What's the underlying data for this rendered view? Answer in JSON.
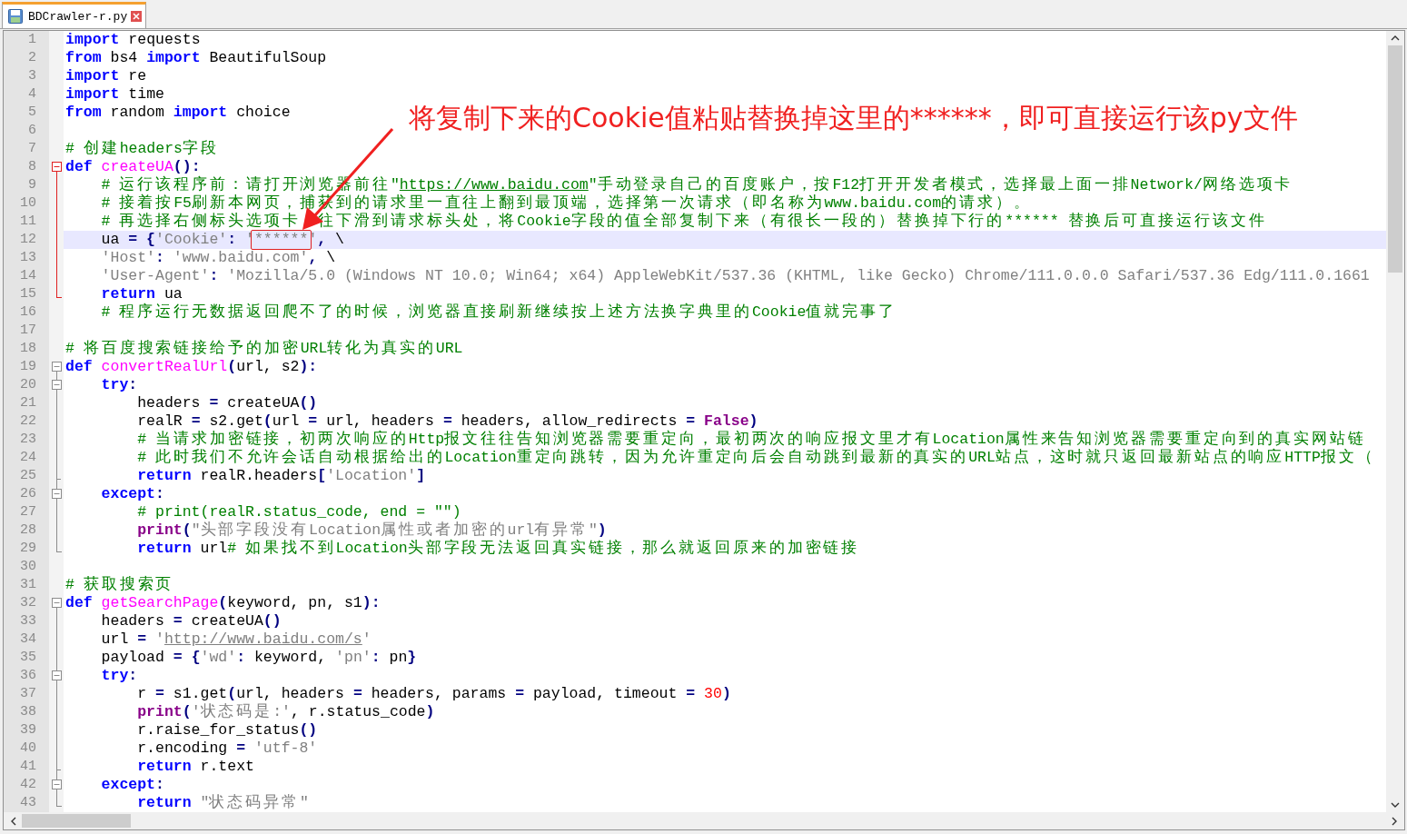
{
  "tabs": [
    {
      "title": "BDCrawler-r.py",
      "selected": true
    }
  ],
  "annotation": {
    "text": "将复制下来的Cookie值粘贴替换掉这里的******，即可直接运行该py文件"
  },
  "lines": [
    {
      "number": "1",
      "current": false,
      "tokens": [
        {
          "kind": "kw",
          "text": "import"
        },
        {
          "kind": "plain",
          "text": " requests"
        }
      ]
    },
    {
      "number": "2",
      "current": false,
      "tokens": [
        {
          "kind": "kw",
          "text": "from"
        },
        {
          "kind": "plain",
          "text": " bs4 "
        },
        {
          "kind": "kw",
          "text": "import"
        },
        {
          "kind": "plain",
          "text": " BeautifulSoup"
        }
      ]
    },
    {
      "number": "3",
      "current": false,
      "tokens": [
        {
          "kind": "kw",
          "text": "import"
        },
        {
          "kind": "plain",
          "text": " re"
        }
      ]
    },
    {
      "number": "4",
      "current": false,
      "tokens": [
        {
          "kind": "kw",
          "text": "import"
        },
        {
          "kind": "plain",
          "text": " time"
        }
      ]
    },
    {
      "number": "5",
      "current": false,
      "tokens": [
        {
          "kind": "kw",
          "text": "from"
        },
        {
          "kind": "plain",
          "text": " random "
        },
        {
          "kind": "kw",
          "text": "import"
        },
        {
          "kind": "plain",
          "text": " choice"
        }
      ]
    },
    {
      "number": "6",
      "current": false
    },
    {
      "number": "7",
      "current": false,
      "tokens": [
        {
          "kind": "cm",
          "text": "# 创建headers字段"
        }
      ]
    },
    {
      "number": "8",
      "current": false,
      "fold": {
        "kind": "open",
        "active": true
      },
      "tokens": [
        {
          "kind": "kw",
          "text": "def "
        },
        {
          "kind": "fn",
          "text": "createUA"
        },
        {
          "kind": "op",
          "text": "():"
        }
      ]
    },
    {
      "number": "9",
      "current": false,
      "fold": {
        "kind": "line",
        "active": true
      },
      "tokens": [
        {
          "kind": "cm",
          "text": "    # 运行该程序前：请打开浏览器前往\""
        },
        {
          "kind": "cmlink",
          "text": "https://www.baidu.com"
        },
        {
          "kind": "cm",
          "text": "\"手动登录自己的百度账户，按F12打开开发者模式，选择最上面一排Network/网络选项卡"
        }
      ]
    },
    {
      "number": "10",
      "current": false,
      "fold": {
        "kind": "line",
        "active": true
      },
      "tokens": [
        {
          "kind": "cm",
          "text": "    # 接着按F5刷新本网页，捕获到的请求里一直往上翻到最顶端，选择第一次请求（即名称为www.baidu.com的请求）。"
        }
      ]
    },
    {
      "number": "11",
      "current": false,
      "fold": {
        "kind": "line",
        "active": true
      },
      "tokens": [
        {
          "kind": "cm",
          "text": "    # 再选择右侧标头选项卡　往下滑到请求标头处，将Cookie字段的值全部复制下来（有很长一段的）替换掉下行的****** 替换后可直接运行该文件"
        }
      ]
    },
    {
      "number": "12",
      "current": true,
      "fold": {
        "kind": "line",
        "active": true
      },
      "tokens": [
        {
          "kind": "plain",
          "text": "    ua "
        },
        {
          "kind": "op",
          "text": "= {"
        },
        {
          "kind": "str",
          "text": "'Cookie'"
        },
        {
          "kind": "op",
          "text": ":"
        },
        {
          "kind": "str",
          "text": " '"
        },
        {
          "kind": "str",
          "text": "******",
          "boxed": true
        },
        {
          "kind": "str",
          "text": "'"
        },
        {
          "kind": "op",
          "text": ","
        },
        {
          "kind": "plain",
          "text": " \\"
        }
      ]
    },
    {
      "number": "13",
      "current": false,
      "fold": {
        "kind": "line",
        "active": true
      },
      "tokens": [
        {
          "kind": "str",
          "text": "    'Host'"
        },
        {
          "kind": "op",
          "text": ":"
        },
        {
          "kind": "str",
          "text": " 'www.baidu.com'"
        },
        {
          "kind": "op",
          "text": ","
        },
        {
          "kind": "plain",
          "text": " \\"
        }
      ]
    },
    {
      "number": "14",
      "current": false,
      "fold": {
        "kind": "line",
        "active": true
      },
      "tokens": [
        {
          "kind": "str",
          "text": "    'User-Agent'"
        },
        {
          "kind": "op",
          "text": ":"
        },
        {
          "kind": "str",
          "text": " 'Mozilla/5.0 (Windows NT 10.0; Win64; x64) AppleWebKit/537.36 (KHTML, like Gecko) Chrome/111.0.0.0 Safari/537.36 Edg/111.0.1661"
        }
      ]
    },
    {
      "number": "15",
      "current": false,
      "fold": {
        "kind": "end",
        "active": true
      },
      "tokens": [
        {
          "kind": "kw",
          "text": "    return"
        },
        {
          "kind": "plain",
          "text": " ua"
        }
      ]
    },
    {
      "number": "16",
      "current": false,
      "tokens": [
        {
          "kind": "cm",
          "text": "    # 程序运行无数据返回爬不了的时候，浏览器直接刷新继续按上述方法换字典里的Cookie值就完事了"
        }
      ]
    },
    {
      "number": "17",
      "current": false
    },
    {
      "number": "18",
      "current": false,
      "tokens": [
        {
          "kind": "cm",
          "text": "# 将百度搜索链接给予的加密URL转化为真实的URL"
        }
      ]
    },
    {
      "number": "19",
      "current": false,
      "fold": {
        "kind": "open",
        "active": false
      },
      "tokens": [
        {
          "kind": "kw",
          "text": "def "
        },
        {
          "kind": "fn",
          "text": "convertRealUrl"
        },
        {
          "kind": "op",
          "text": "("
        },
        {
          "kind": "plain",
          "text": "url, s2"
        },
        {
          "kind": "op",
          "text": "):"
        }
      ]
    },
    {
      "number": "20",
      "current": false,
      "fold": {
        "kind": "open",
        "active": false
      },
      "tokens": [
        {
          "kind": "kw",
          "text": "    try"
        },
        {
          "kind": "op",
          "text": ":"
        }
      ]
    },
    {
      "number": "21",
      "current": false,
      "fold": {
        "kind": "line",
        "active": false
      },
      "tokens": [
        {
          "kind": "plain",
          "text": "        headers "
        },
        {
          "kind": "op",
          "text": "="
        },
        {
          "kind": "plain",
          "text": " createUA"
        },
        {
          "kind": "op",
          "text": "()"
        }
      ]
    },
    {
      "number": "22",
      "current": false,
      "fold": {
        "kind": "line",
        "active": false
      },
      "tokens": [
        {
          "kind": "plain",
          "text": "        realR "
        },
        {
          "kind": "op",
          "text": "="
        },
        {
          "kind": "plain",
          "text": " s2.get"
        },
        {
          "kind": "op",
          "text": "("
        },
        {
          "kind": "plain",
          "text": "url "
        },
        {
          "kind": "op",
          "text": "="
        },
        {
          "kind": "plain",
          "text": " url, headers "
        },
        {
          "kind": "op",
          "text": "="
        },
        {
          "kind": "plain",
          "text": " headers, allow_redirects "
        },
        {
          "kind": "op",
          "text": "="
        },
        {
          "kind": "builtin",
          "text": " False"
        },
        {
          "kind": "op",
          "text": ")"
        }
      ]
    },
    {
      "number": "23",
      "current": false,
      "fold": {
        "kind": "line",
        "active": false
      },
      "tokens": [
        {
          "kind": "cm",
          "text": "        # 当请求加密链接，初两次响应的Http报文往往告知浏览器需要重定向，最初两次的响应报文里才有Location属性来告知浏览器需要重定向到的真实网站链"
        }
      ]
    },
    {
      "number": "24",
      "current": false,
      "fold": {
        "kind": "line",
        "active": false
      },
      "tokens": [
        {
          "kind": "cm",
          "text": "        # 此时我们不允许会话自动根据给出的Location重定向跳转，因为允许重定向后会自动跳到最新的真实的URL站点，这时就只返回最新站点的响应HTTP报文（"
        }
      ]
    },
    {
      "number": "25",
      "current": false,
      "fold": {
        "kind": "branch",
        "active": false
      },
      "tokens": [
        {
          "kind": "kw",
          "text": "        return"
        },
        {
          "kind": "plain",
          "text": " realR.headers"
        },
        {
          "kind": "op",
          "text": "["
        },
        {
          "kind": "str",
          "text": "'Location'"
        },
        {
          "kind": "op",
          "text": "]"
        }
      ]
    },
    {
      "number": "26",
      "current": false,
      "fold": {
        "kind": "open",
        "active": false
      },
      "tokens": [
        {
          "kind": "kw",
          "text": "    except"
        },
        {
          "kind": "op",
          "text": ":"
        }
      ]
    },
    {
      "number": "27",
      "current": false,
      "fold": {
        "kind": "line",
        "active": false
      },
      "tokens": [
        {
          "kind": "cm",
          "text": "        # print(realR.status_code, end = \"\")"
        }
      ]
    },
    {
      "number": "28",
      "current": false,
      "fold": {
        "kind": "line",
        "active": false
      },
      "tokens": [
        {
          "kind": "builtin",
          "text": "        print"
        },
        {
          "kind": "op",
          "text": "("
        },
        {
          "kind": "str",
          "text": "\"头部字段没有Location属性或者加密的url有异常\""
        },
        {
          "kind": "op",
          "text": ")"
        }
      ]
    },
    {
      "number": "29",
      "current": false,
      "fold": {
        "kind": "end",
        "active": false
      },
      "tokens": [
        {
          "kind": "kw",
          "text": "        return"
        },
        {
          "kind": "plain",
          "text": " url"
        },
        {
          "kind": "cm",
          "text": "# 如果找不到Location头部字段无法返回真实链接，那么就返回原来的加密链接"
        }
      ]
    },
    {
      "number": "30",
      "current": false
    },
    {
      "number": "31",
      "current": false,
      "tokens": [
        {
          "kind": "cm",
          "text": "# 获取搜索页"
        }
      ]
    },
    {
      "number": "32",
      "current": false,
      "fold": {
        "kind": "open",
        "active": false
      },
      "tokens": [
        {
          "kind": "kw",
          "text": "def "
        },
        {
          "kind": "fn",
          "text": "getSearchPage"
        },
        {
          "kind": "op",
          "text": "("
        },
        {
          "kind": "plain",
          "text": "keyword, pn, s1"
        },
        {
          "kind": "op",
          "text": "):"
        }
      ]
    },
    {
      "number": "33",
      "current": false,
      "fold": {
        "kind": "line",
        "active": false
      },
      "tokens": [
        {
          "kind": "plain",
          "text": "    headers "
        },
        {
          "kind": "op",
          "text": "="
        },
        {
          "kind": "plain",
          "text": " createUA"
        },
        {
          "kind": "op",
          "text": "()"
        }
      ]
    },
    {
      "number": "34",
      "current": false,
      "fold": {
        "kind": "line",
        "active": false
      },
      "tokens": [
        {
          "kind": "plain",
          "text": "    url "
        },
        {
          "kind": "op",
          "text": "="
        },
        {
          "kind": "str",
          "text": " '"
        },
        {
          "kind": "strlink",
          "text": "http://www.baidu.com/s"
        },
        {
          "kind": "str",
          "text": "'"
        }
      ]
    },
    {
      "number": "35",
      "current": false,
      "fold": {
        "kind": "line",
        "active": false
      },
      "tokens": [
        {
          "kind": "plain",
          "text": "    payload "
        },
        {
          "kind": "op",
          "text": "= {"
        },
        {
          "kind": "str",
          "text": "'wd'"
        },
        {
          "kind": "op",
          "text": ":"
        },
        {
          "kind": "plain",
          "text": " keyword, "
        },
        {
          "kind": "str",
          "text": "'pn'"
        },
        {
          "kind": "op",
          "text": ":"
        },
        {
          "kind": "plain",
          "text": " pn"
        },
        {
          "kind": "op",
          "text": "}"
        }
      ]
    },
    {
      "number": "36",
      "current": false,
      "fold": {
        "kind": "open",
        "active": false
      },
      "tokens": [
        {
          "kind": "kw",
          "text": "    try"
        },
        {
          "kind": "op",
          "text": ":"
        }
      ]
    },
    {
      "number": "37",
      "current": false,
      "fold": {
        "kind": "line",
        "active": false
      },
      "tokens": [
        {
          "kind": "plain",
          "text": "        r "
        },
        {
          "kind": "op",
          "text": "="
        },
        {
          "kind": "plain",
          "text": " s1.get"
        },
        {
          "kind": "op",
          "text": "("
        },
        {
          "kind": "plain",
          "text": "url, headers "
        },
        {
          "kind": "op",
          "text": "="
        },
        {
          "kind": "plain",
          "text": " headers, params "
        },
        {
          "kind": "op",
          "text": "="
        },
        {
          "kind": "plain",
          "text": " payload, timeout "
        },
        {
          "kind": "op",
          "text": "="
        },
        {
          "kind": "num",
          "text": " 30"
        },
        {
          "kind": "op",
          "text": ")"
        }
      ]
    },
    {
      "number": "38",
      "current": false,
      "fold": {
        "kind": "line",
        "active": false
      },
      "tokens": [
        {
          "kind": "builtin",
          "text": "        print"
        },
        {
          "kind": "op",
          "text": "("
        },
        {
          "kind": "str",
          "text": "'状态码是:'"
        },
        {
          "kind": "plain",
          "text": ", r.status_code"
        },
        {
          "kind": "op",
          "text": ")"
        }
      ]
    },
    {
      "number": "39",
      "current": false,
      "fold": {
        "kind": "line",
        "active": false
      },
      "tokens": [
        {
          "kind": "plain",
          "text": "        r.raise_for_status"
        },
        {
          "kind": "op",
          "text": "()"
        }
      ]
    },
    {
      "number": "40",
      "current": false,
      "fold": {
        "kind": "line",
        "active": false
      },
      "tokens": [
        {
          "kind": "plain",
          "text": "        r.encoding "
        },
        {
          "kind": "op",
          "text": "="
        },
        {
          "kind": "str",
          "text": " 'utf-8'"
        }
      ]
    },
    {
      "number": "41",
      "current": false,
      "fold": {
        "kind": "branch",
        "active": false
      },
      "tokens": [
        {
          "kind": "kw",
          "text": "        return"
        },
        {
          "kind": "plain",
          "text": " r.text"
        }
      ]
    },
    {
      "number": "42",
      "current": false,
      "fold": {
        "kind": "open",
        "active": false
      },
      "tokens": [
        {
          "kind": "kw",
          "text": "    except"
        },
        {
          "kind": "op",
          "text": ":"
        }
      ]
    },
    {
      "number": "43",
      "current": false,
      "fold": {
        "kind": "end",
        "active": false
      },
      "tokens": [
        {
          "kind": "kw",
          "text": "        return"
        },
        {
          "kind": "str",
          "text": " \"状态码异常\""
        }
      ]
    }
  ]
}
